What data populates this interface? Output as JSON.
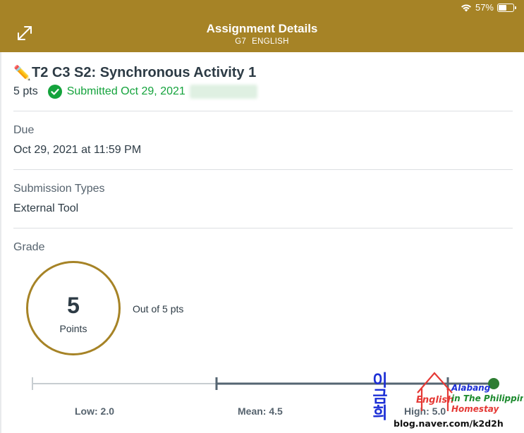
{
  "status_bar": {
    "wifi_icon": "wifi-icon",
    "battery_percent": "57%",
    "battery_level": 0.57
  },
  "header": {
    "title": "Assignment Details",
    "course_code": "G7",
    "course_name": "ENGLISH",
    "expand_icon": "expand-icon",
    "color": "#a68326"
  },
  "assignment": {
    "emoji": "✏️",
    "title": "T2 C3 S2: Synchronous Activity 1",
    "points": "5 pts",
    "status_icon": "check-circle-icon",
    "status": "Submitted Oct 29, 2021",
    "status_color": "#14a33c"
  },
  "due": {
    "label": "Due",
    "value": "Oct 29, 2021 at 11:59 PM"
  },
  "submission_types": {
    "label": "Submission Types",
    "value": "External Tool"
  },
  "grade": {
    "label": "Grade",
    "score": "5",
    "unit": "Points",
    "out_of": "Out of 5 pts",
    "stats": {
      "low_label": "Low: 2.0",
      "mean_label": "Mean: 4.5",
      "high_label": "High: 5.0",
      "low": 2.0,
      "mean": 4.5,
      "high": 5.0,
      "score": 5.0
    }
  },
  "watermark": {
    "hangul": "이금희",
    "line1": "English",
    "line2": "Homestay",
    "line3": "Alabang",
    "line4": "in The Philippines",
    "url": "blog.naver.com/k2d2h"
  }
}
